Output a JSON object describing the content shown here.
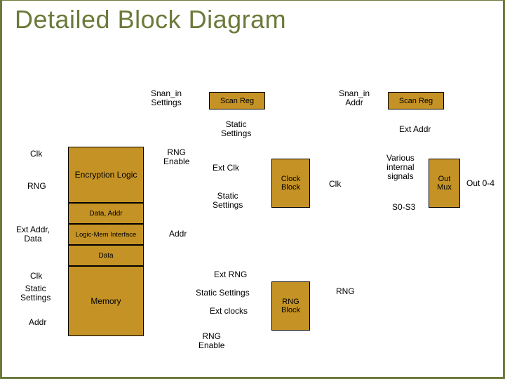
{
  "title": "Detailed Block Diagram",
  "blocks": {
    "scan_reg_1": "Scan Reg",
    "scan_reg_2": "Scan Reg",
    "clock_block": "Clock\nBlock",
    "out_mux": "Out\nMux",
    "rng_block": "RNG\nBlock",
    "encryption_logic": "Encryption\nLogic",
    "data_addr": "Data, Addr",
    "logic_mem_if": "Logic-Mem Interface",
    "data": "Data",
    "memory": "Memory"
  },
  "labels": {
    "snan_in_settings": "Snan_in\nSettings",
    "snan_in_addr": "Snan_in\nAddr",
    "static_settings_top": "Static\nSettings",
    "ext_addr_top": "Ext Addr",
    "clk_left1": "Clk",
    "rng_left": "RNG",
    "ext_addr_data": "Ext Addr,\nData",
    "clk_left2": "Clk",
    "static_settings_left": "Static\nSettings",
    "addr_left": "Addr",
    "rng_enable1": "RNG\nEnable",
    "ext_clk": "Ext Clk",
    "static_settings_mid": "Static\nSettings",
    "addr_mid": "Addr",
    "ext_rng": "Ext RNG",
    "static_settings_mem": "Static Settings",
    "ext_clocks": "Ext clocks",
    "rng_enable2": "RNG\nEnable",
    "clk_mid_right": "Clk",
    "various_signals": "Various\ninternal\nsignals",
    "s0_s3": "S0-S3",
    "out_0_4": "Out 0-4",
    "rng_right": "RNG"
  }
}
